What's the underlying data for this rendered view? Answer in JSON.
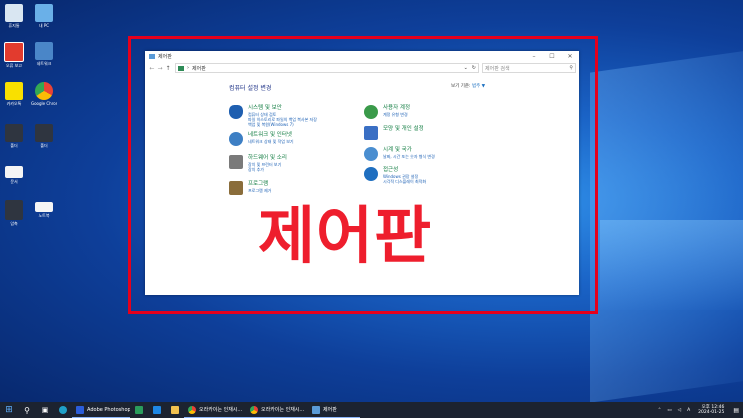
{
  "desktop": {
    "icons": [
      {
        "label": "휴지통",
        "color": "#d9e6f2"
      },
      {
        "label": "내 PC",
        "color": "#6ab0e8"
      },
      {
        "label": "오류 보고",
        "color": "#e23b2e"
      },
      {
        "label": "네트워크",
        "color": "#4a86c8"
      },
      {
        "label": "카카오톡",
        "color": "#f9e000"
      },
      {
        "label": "Google Chrome",
        "color": "#34a853"
      },
      {
        "label": "폴더",
        "color": "#2f3540"
      },
      {
        "label": "폴더",
        "color": "#2f3540"
      },
      {
        "label": "문서",
        "color": "#f5f5f5"
      },
      {
        "label": "압축",
        "color": "#2f3540"
      },
      {
        "label": "노트북",
        "color": "#f5f5f5"
      }
    ]
  },
  "window": {
    "title": "제어판",
    "address": "제어판",
    "search_placeholder": "제어판 검색",
    "heading": "컴퓨터 설정 변경",
    "view_by_label": "보기 기준:",
    "view_by_value": "범주 ▼",
    "categories_left": [
      {
        "title": "시스템 및 보안",
        "subs": [
          "컴퓨터 상태 검토",
          "파일 히스토리로 파일의 백업 복사본 저장",
          "백업 및 복원(Windows 7)"
        ],
        "color": "#1f5fb0"
      },
      {
        "title": "네트워크 및 인터넷",
        "subs": [
          "네트워크 상태 및 작업 보기"
        ],
        "color": "#3d7fc4"
      },
      {
        "title": "하드웨어 및 소리",
        "subs": [
          "장치 및 프린터 보기",
          "장치 추가"
        ],
        "color": "#7a7a7a"
      },
      {
        "title": "프로그램",
        "subs": [
          "프로그램 제거"
        ],
        "color": "#8a6d3b"
      }
    ],
    "categories_right": [
      {
        "title": "사용자 계정",
        "subs": [
          "계정 유형 변경"
        ],
        "color": "#3a9a4a"
      },
      {
        "title": "모양 및 개인 설정",
        "subs": [],
        "color": "#3a6fc4"
      },
      {
        "title": "시계 및 국가",
        "subs": [
          "날짜, 시간 또는 숫자 형식 변경"
        ],
        "color": "#4a8ed0"
      },
      {
        "title": "접근성",
        "subs": [
          "Windows 권장 설정",
          "시각적 디스플레이 최적화"
        ],
        "color": "#1f6fc0"
      }
    ]
  },
  "overlay_text": "제어판",
  "taskbar": {
    "apps": [
      {
        "label": "Adobe Photoshop ...",
        "color": "#2b5dd9"
      },
      {
        "label": "오라카이는 인재시...",
        "color": "#34a853"
      },
      {
        "label": "오라카이는 인재시...",
        "color": "#34a853"
      },
      {
        "label": "제어판",
        "color": "#5a9bd8"
      }
    ],
    "clock_time": "오후 12:46",
    "clock_date": "2024-01-25",
    "lang": "A"
  }
}
